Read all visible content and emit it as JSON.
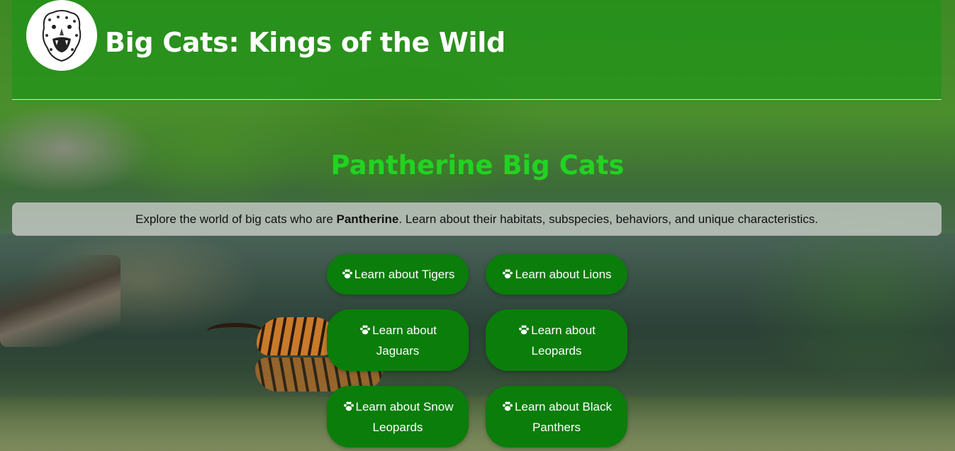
{
  "header": {
    "title": "Big Cats: Kings of the Wild",
    "logo_icon": "jaguar-head-icon"
  },
  "main": {
    "heading": "Pantherine Big Cats",
    "intro": {
      "before": "Explore the world of big cats who are ",
      "bold": "Pantherine",
      "after": ". Learn about their habitats, subspecies, behaviors, and unique characteristics."
    },
    "buttons": [
      {
        "label": "Learn about Tigers",
        "icon": "paw-icon"
      },
      {
        "label": "Learn about Lions",
        "icon": "paw-icon"
      },
      {
        "label": "Learn about Jaguars",
        "icon": "paw-icon"
      },
      {
        "label": "Learn about Leopards",
        "icon": "paw-icon"
      },
      {
        "label": "Learn about Snow Leopards",
        "icon": "paw-icon"
      },
      {
        "label": "Learn about Black Panthers",
        "icon": "paw-icon"
      }
    ]
  },
  "colors": {
    "button_bg": "#0a7d0a",
    "heading": "#22d322",
    "header_overlay": "rgba(20,150,20,0.55)"
  }
}
